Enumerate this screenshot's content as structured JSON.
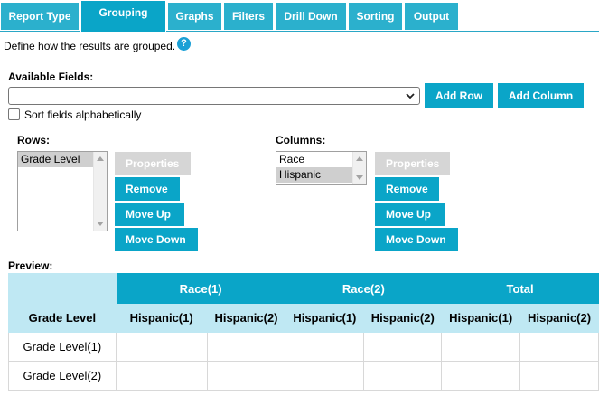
{
  "tabs": [
    {
      "label": "Report Type",
      "active": false
    },
    {
      "label": "Grouping",
      "active": true
    },
    {
      "label": "Graphs",
      "active": false
    },
    {
      "label": "Filters",
      "active": false
    },
    {
      "label": "Drill Down",
      "active": false
    },
    {
      "label": "Sorting",
      "active": false
    },
    {
      "label": "Output",
      "active": false
    }
  ],
  "intro": "Define how the results are grouped.",
  "help_icon": "?",
  "available": {
    "label": "Available Fields:",
    "selected_value": "",
    "add_row": "Add Row",
    "add_column": "Add Column",
    "sort_label": "Sort fields alphabetically",
    "sort_checked": false
  },
  "rows": {
    "label": "Rows:",
    "items": [
      {
        "label": "Grade Level",
        "selected": true
      }
    ],
    "buttons": {
      "properties": "Properties",
      "remove": "Remove",
      "move_up": "Move Up",
      "move_down": "Move Down"
    }
  },
  "columns": {
    "label": "Columns:",
    "items": [
      {
        "label": "Race",
        "selected": false
      },
      {
        "label": "Hispanic",
        "selected": true
      }
    ],
    "buttons": {
      "properties": "Properties",
      "remove": "Remove",
      "move_up": "Move Up",
      "move_down": "Move Down"
    }
  },
  "preview": {
    "label": "Preview:",
    "top_headers": [
      "Race(1)",
      "Race(2)",
      "Total"
    ],
    "row_header": "Grade Level",
    "sub_headers": [
      "Hispanic(1)",
      "Hispanic(2)",
      "Hispanic(1)",
      "Hispanic(2)",
      "Hispanic(1)",
      "Hispanic(2)"
    ],
    "rows": [
      "Grade Level(1)",
      "Grade Level(2)"
    ]
  },
  "colors": {
    "accent": "#0aa5c8",
    "tab": "#2bb0cd",
    "light": "#bfe8f3",
    "disabled": "#d6d6d6"
  }
}
